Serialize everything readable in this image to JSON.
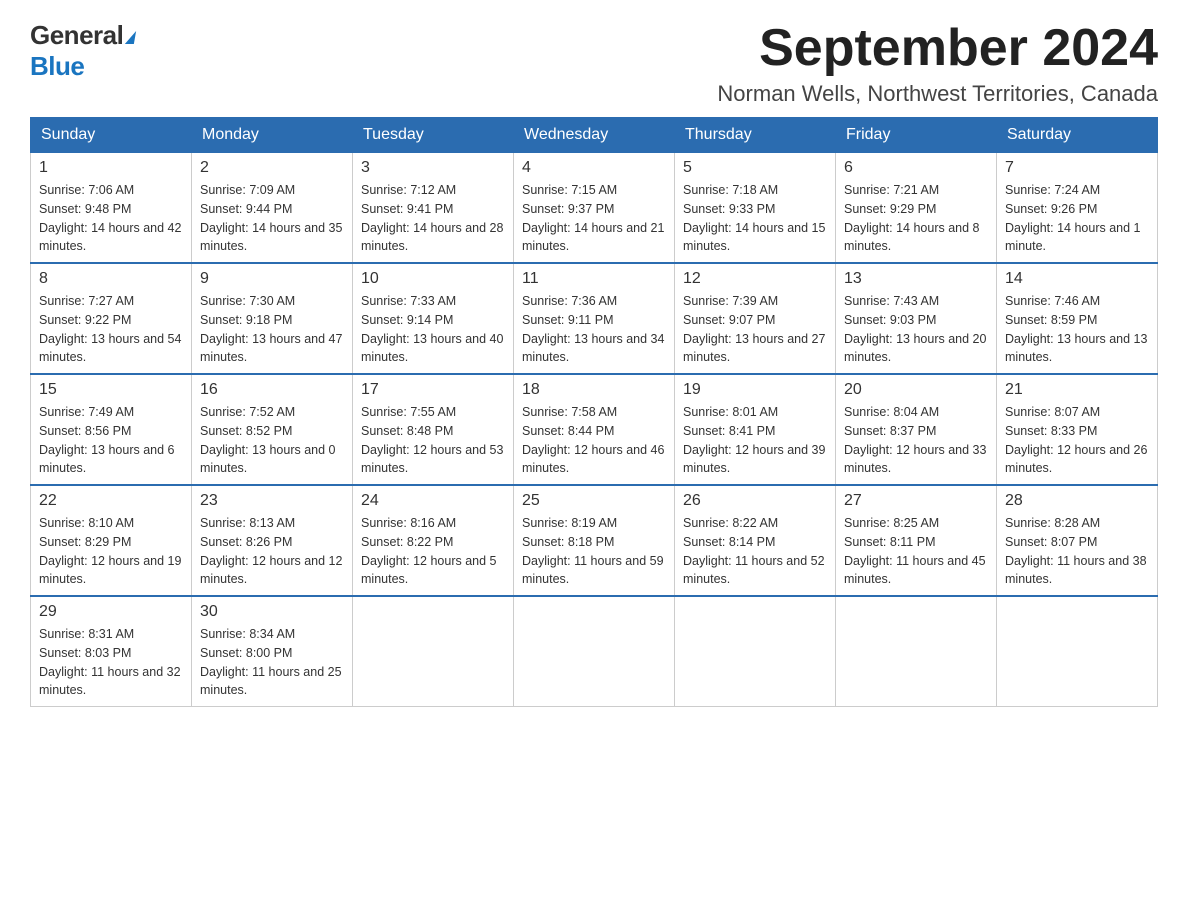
{
  "header": {
    "logo_general": "General",
    "logo_blue": "Blue",
    "month_title": "September 2024",
    "location": "Norman Wells, Northwest Territories, Canada"
  },
  "days_of_week": [
    "Sunday",
    "Monday",
    "Tuesday",
    "Wednesday",
    "Thursday",
    "Friday",
    "Saturday"
  ],
  "weeks": [
    [
      {
        "day": "1",
        "sunrise": "Sunrise: 7:06 AM",
        "sunset": "Sunset: 9:48 PM",
        "daylight": "Daylight: 14 hours and 42 minutes."
      },
      {
        "day": "2",
        "sunrise": "Sunrise: 7:09 AM",
        "sunset": "Sunset: 9:44 PM",
        "daylight": "Daylight: 14 hours and 35 minutes."
      },
      {
        "day": "3",
        "sunrise": "Sunrise: 7:12 AM",
        "sunset": "Sunset: 9:41 PM",
        "daylight": "Daylight: 14 hours and 28 minutes."
      },
      {
        "day": "4",
        "sunrise": "Sunrise: 7:15 AM",
        "sunset": "Sunset: 9:37 PM",
        "daylight": "Daylight: 14 hours and 21 minutes."
      },
      {
        "day": "5",
        "sunrise": "Sunrise: 7:18 AM",
        "sunset": "Sunset: 9:33 PM",
        "daylight": "Daylight: 14 hours and 15 minutes."
      },
      {
        "day": "6",
        "sunrise": "Sunrise: 7:21 AM",
        "sunset": "Sunset: 9:29 PM",
        "daylight": "Daylight: 14 hours and 8 minutes."
      },
      {
        "day": "7",
        "sunrise": "Sunrise: 7:24 AM",
        "sunset": "Sunset: 9:26 PM",
        "daylight": "Daylight: 14 hours and 1 minute."
      }
    ],
    [
      {
        "day": "8",
        "sunrise": "Sunrise: 7:27 AM",
        "sunset": "Sunset: 9:22 PM",
        "daylight": "Daylight: 13 hours and 54 minutes."
      },
      {
        "day": "9",
        "sunrise": "Sunrise: 7:30 AM",
        "sunset": "Sunset: 9:18 PM",
        "daylight": "Daylight: 13 hours and 47 minutes."
      },
      {
        "day": "10",
        "sunrise": "Sunrise: 7:33 AM",
        "sunset": "Sunset: 9:14 PM",
        "daylight": "Daylight: 13 hours and 40 minutes."
      },
      {
        "day": "11",
        "sunrise": "Sunrise: 7:36 AM",
        "sunset": "Sunset: 9:11 PM",
        "daylight": "Daylight: 13 hours and 34 minutes."
      },
      {
        "day": "12",
        "sunrise": "Sunrise: 7:39 AM",
        "sunset": "Sunset: 9:07 PM",
        "daylight": "Daylight: 13 hours and 27 minutes."
      },
      {
        "day": "13",
        "sunrise": "Sunrise: 7:43 AM",
        "sunset": "Sunset: 9:03 PM",
        "daylight": "Daylight: 13 hours and 20 minutes."
      },
      {
        "day": "14",
        "sunrise": "Sunrise: 7:46 AM",
        "sunset": "Sunset: 8:59 PM",
        "daylight": "Daylight: 13 hours and 13 minutes."
      }
    ],
    [
      {
        "day": "15",
        "sunrise": "Sunrise: 7:49 AM",
        "sunset": "Sunset: 8:56 PM",
        "daylight": "Daylight: 13 hours and 6 minutes."
      },
      {
        "day": "16",
        "sunrise": "Sunrise: 7:52 AM",
        "sunset": "Sunset: 8:52 PM",
        "daylight": "Daylight: 13 hours and 0 minutes."
      },
      {
        "day": "17",
        "sunrise": "Sunrise: 7:55 AM",
        "sunset": "Sunset: 8:48 PM",
        "daylight": "Daylight: 12 hours and 53 minutes."
      },
      {
        "day": "18",
        "sunrise": "Sunrise: 7:58 AM",
        "sunset": "Sunset: 8:44 PM",
        "daylight": "Daylight: 12 hours and 46 minutes."
      },
      {
        "day": "19",
        "sunrise": "Sunrise: 8:01 AM",
        "sunset": "Sunset: 8:41 PM",
        "daylight": "Daylight: 12 hours and 39 minutes."
      },
      {
        "day": "20",
        "sunrise": "Sunrise: 8:04 AM",
        "sunset": "Sunset: 8:37 PM",
        "daylight": "Daylight: 12 hours and 33 minutes."
      },
      {
        "day": "21",
        "sunrise": "Sunrise: 8:07 AM",
        "sunset": "Sunset: 8:33 PM",
        "daylight": "Daylight: 12 hours and 26 minutes."
      }
    ],
    [
      {
        "day": "22",
        "sunrise": "Sunrise: 8:10 AM",
        "sunset": "Sunset: 8:29 PM",
        "daylight": "Daylight: 12 hours and 19 minutes."
      },
      {
        "day": "23",
        "sunrise": "Sunrise: 8:13 AM",
        "sunset": "Sunset: 8:26 PM",
        "daylight": "Daylight: 12 hours and 12 minutes."
      },
      {
        "day": "24",
        "sunrise": "Sunrise: 8:16 AM",
        "sunset": "Sunset: 8:22 PM",
        "daylight": "Daylight: 12 hours and 5 minutes."
      },
      {
        "day": "25",
        "sunrise": "Sunrise: 8:19 AM",
        "sunset": "Sunset: 8:18 PM",
        "daylight": "Daylight: 11 hours and 59 minutes."
      },
      {
        "day": "26",
        "sunrise": "Sunrise: 8:22 AM",
        "sunset": "Sunset: 8:14 PM",
        "daylight": "Daylight: 11 hours and 52 minutes."
      },
      {
        "day": "27",
        "sunrise": "Sunrise: 8:25 AM",
        "sunset": "Sunset: 8:11 PM",
        "daylight": "Daylight: 11 hours and 45 minutes."
      },
      {
        "day": "28",
        "sunrise": "Sunrise: 8:28 AM",
        "sunset": "Sunset: 8:07 PM",
        "daylight": "Daylight: 11 hours and 38 minutes."
      }
    ],
    [
      {
        "day": "29",
        "sunrise": "Sunrise: 8:31 AM",
        "sunset": "Sunset: 8:03 PM",
        "daylight": "Daylight: 11 hours and 32 minutes."
      },
      {
        "day": "30",
        "sunrise": "Sunrise: 8:34 AM",
        "sunset": "Sunset: 8:00 PM",
        "daylight": "Daylight: 11 hours and 25 minutes."
      },
      null,
      null,
      null,
      null,
      null
    ]
  ]
}
